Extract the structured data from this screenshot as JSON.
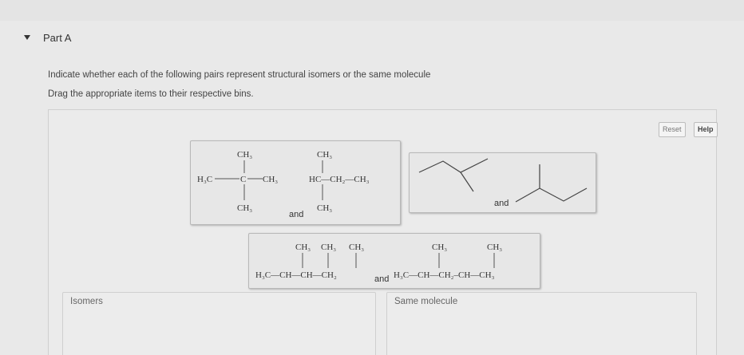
{
  "part": {
    "title": "Part A"
  },
  "instructions": {
    "line1": "Indicate whether each of the following pairs represent structural isomers or the same molecule",
    "line2": "Drag the appropriate items to their respective bins."
  },
  "toolbar": {
    "reset_label": "Reset",
    "help_label": "Help"
  },
  "cards": [
    {
      "joiner": "and",
      "molecule_a": {
        "top": "CH₃",
        "left": "H₃C",
        "center": "C",
        "right": "CH₃",
        "bottom": "CH₃"
      },
      "molecule_b": {
        "top": "CH₃",
        "chain": "HC—CH₂—CH₃",
        "bottom": "CH₃"
      }
    },
    {
      "joiner": "and"
    },
    {
      "joiner": "and",
      "molecule_a": {
        "subs": [
          "CH₃",
          "CH₃",
          "CH₃"
        ],
        "chain": "H₃C—CH—CH—CH₂"
      },
      "molecule_b": {
        "subs": [
          "CH₃",
          "CH₃"
        ],
        "chain": "H₃C—CH—CH₂–CH—CH₃"
      }
    }
  ],
  "bins": [
    {
      "label": "Isomers"
    },
    {
      "label": "Same molecule"
    }
  ]
}
